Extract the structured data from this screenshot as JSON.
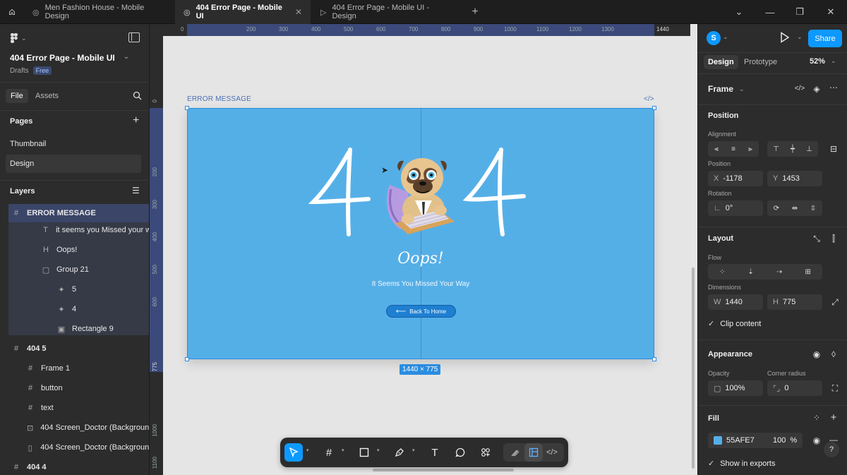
{
  "tabs": {
    "home_icon": "home-icon",
    "tab1": "Men Fashion House - Mobile Design",
    "tab2": "404 Error Page - Mobile UI",
    "tab3": "404 Error Page - Mobile UI - Design",
    "add": "+"
  },
  "left": {
    "file_title": "404 Error Page - Mobile UI",
    "drafts": "Drafts",
    "plan_badge": "Free",
    "tab_file": "File",
    "tab_assets": "Assets",
    "pages_heading": "Pages",
    "pages": [
      "Thumbnail",
      "Design"
    ],
    "layers_heading": "Layers",
    "layers": [
      {
        "name": "ERROR MESSAGE",
        "icon": "#"
      },
      {
        "name": "it seems you Missed your wa",
        "icon": "T"
      },
      {
        "name": "Oops!",
        "icon": "H"
      },
      {
        "name": "Group 21",
        "icon": "▢"
      },
      {
        "name": "5",
        "icon": "✦"
      },
      {
        "name": "4",
        "icon": "✦"
      },
      {
        "name": "Rectangle 9",
        "icon": "▣"
      },
      {
        "name": "404 5",
        "icon": "#"
      },
      {
        "name": "Frame 1",
        "icon": "#"
      },
      {
        "name": "button",
        "icon": "#"
      },
      {
        "name": "text",
        "icon": "#"
      },
      {
        "name": "404 Screen_Doctor (Background/",
        "icon": "⊡"
      },
      {
        "name": "404 Screen_Doctor (Background/",
        "icon": "▯"
      },
      {
        "name": "404 4",
        "icon": "#"
      }
    ]
  },
  "canvas": {
    "ruler_top": [
      "0",
      "200",
      "300",
      "400",
      "500",
      "600",
      "700",
      "800",
      "900",
      "1000",
      "1100",
      "1200",
      "1300",
      "1440"
    ],
    "ruler_left": [
      "0",
      "200",
      "300",
      "400",
      "500",
      "600",
      "775",
      "1000",
      "1100"
    ],
    "frame_label": "ERROR MESSAGE",
    "frame_bg": "#55AFE7",
    "big_left": "4",
    "big_right": "4",
    "oops": "Oops!",
    "subtitle": "It Seems You Missed Your Way",
    "button": "Back To Home",
    "size_badge": "1440 × 775"
  },
  "right": {
    "avatar": "S",
    "share": "Share",
    "tab_design": "Design",
    "tab_prototype": "Prototype",
    "zoom": "52%",
    "frame_label": "Frame",
    "position_heading": "Position",
    "alignment": "Alignment",
    "position_sub": "Position",
    "x_label": "X",
    "x_value": "-1178",
    "y_label": "Y",
    "y_value": "1453",
    "rotation": "Rotation",
    "rotation_value": "0°",
    "layout_heading": "Layout",
    "flow": "Flow",
    "dimensions": "Dimensions",
    "w_label": "W",
    "w_value": "1440",
    "h_label": "H",
    "h_value": "775",
    "clip": "Clip content",
    "appearance": "Appearance",
    "opacity_label": "Opacity",
    "opacity_value": "100%",
    "radius_label": "Corner radius",
    "radius_value": "0",
    "fill_heading": "Fill",
    "fill_hex": "55AFE7",
    "fill_opacity": "100",
    "fill_pct": "%",
    "show_exports": "Show in exports",
    "help": "?"
  },
  "colors": {
    "accent": "#0d99ff",
    "frame": "#55AFE7",
    "button": "#1f7fd0"
  }
}
